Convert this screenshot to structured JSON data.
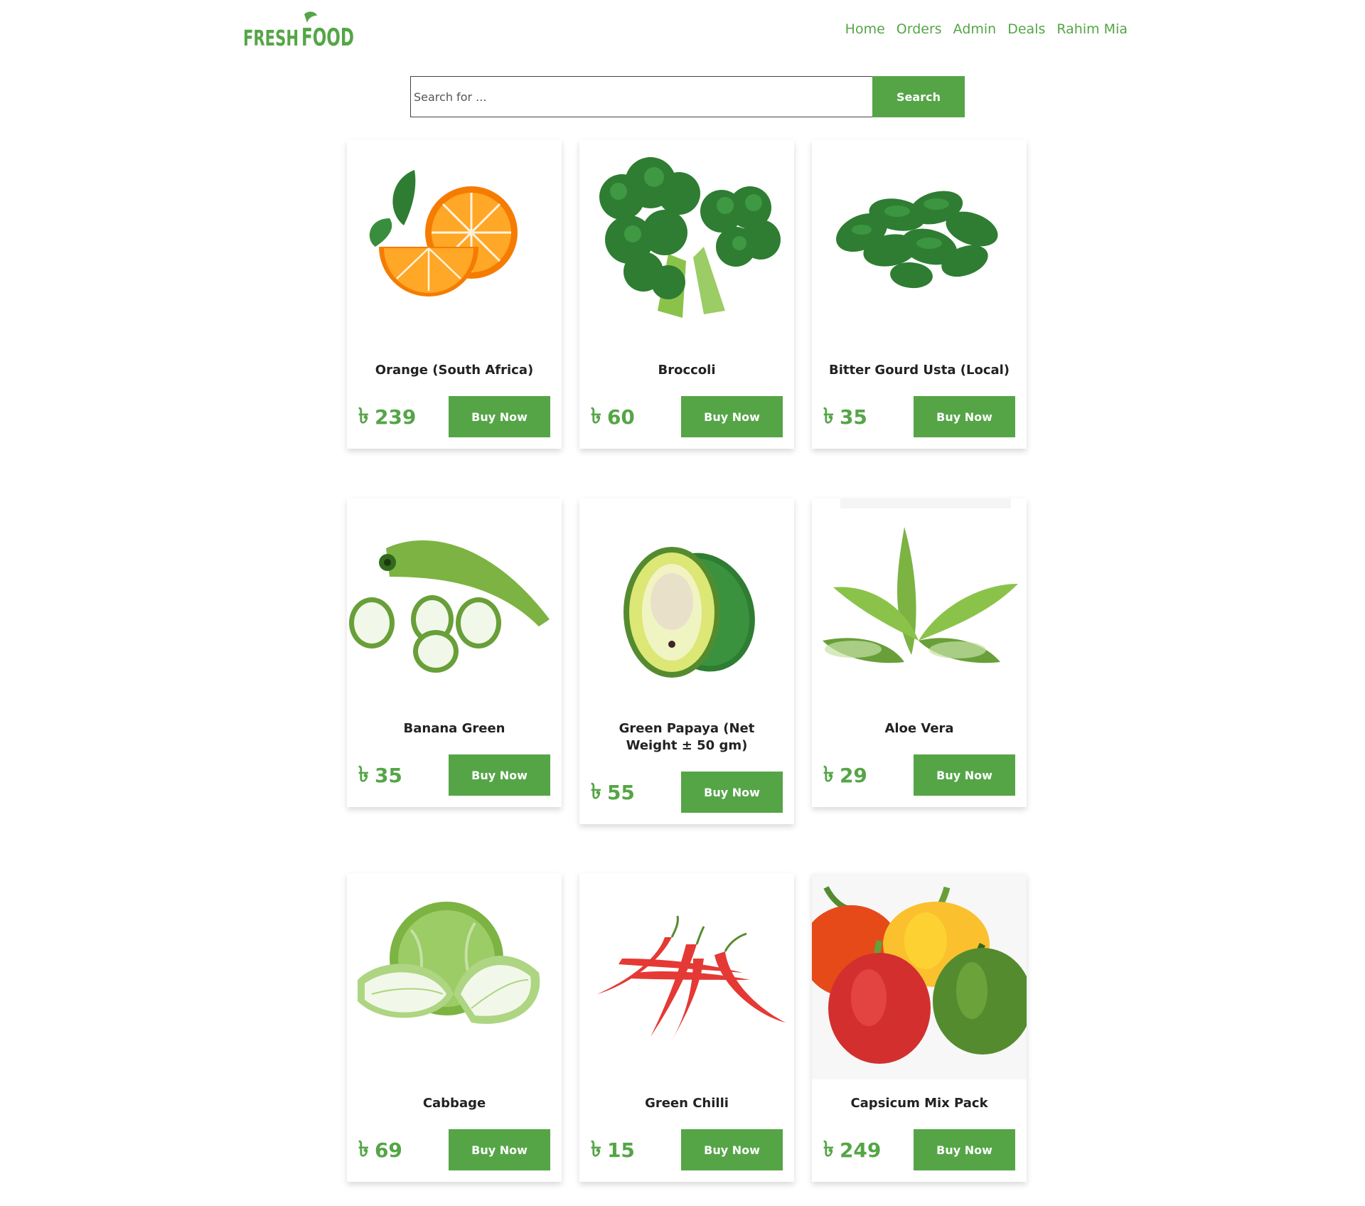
{
  "brand": {
    "logo_text": "FRESH FOOD"
  },
  "nav": [
    "Home",
    "Orders",
    "Admin",
    "Deals",
    "Rahim Mia"
  ],
  "search": {
    "placeholder": "Search for ...",
    "button_label": "Search"
  },
  "currency_symbol": "৳",
  "colors": {
    "accent": "#55a547"
  },
  "products": [
    {
      "name": "Orange (South Africa)",
      "price": "239",
      "button": "Buy Now",
      "icon": "orange"
    },
    {
      "name": "Broccoli",
      "price": "60",
      "button": "Buy Now",
      "icon": "broccoli"
    },
    {
      "name": "Bitter Gourd Usta (Local)",
      "price": "35",
      "button": "Buy Now",
      "icon": "bitter-gourd"
    },
    {
      "name": "Banana Green",
      "price": "35",
      "button": "Buy Now",
      "icon": "green-banana"
    },
    {
      "name": "Green Papaya (Net Weight ± 50 gm)",
      "price": "55",
      "button": "Buy Now",
      "icon": "papaya"
    },
    {
      "name": "Aloe Vera",
      "price": "29",
      "button": "Buy Now",
      "icon": "aloe-vera"
    },
    {
      "name": "Cabbage",
      "price": "69",
      "button": "Buy Now",
      "icon": "cabbage"
    },
    {
      "name": "Green Chilli",
      "price": "15",
      "button": "Buy Now",
      "icon": "chilli"
    },
    {
      "name": "Capsicum Mix Pack",
      "price": "249",
      "button": "Buy Now",
      "icon": "capsicum"
    }
  ]
}
